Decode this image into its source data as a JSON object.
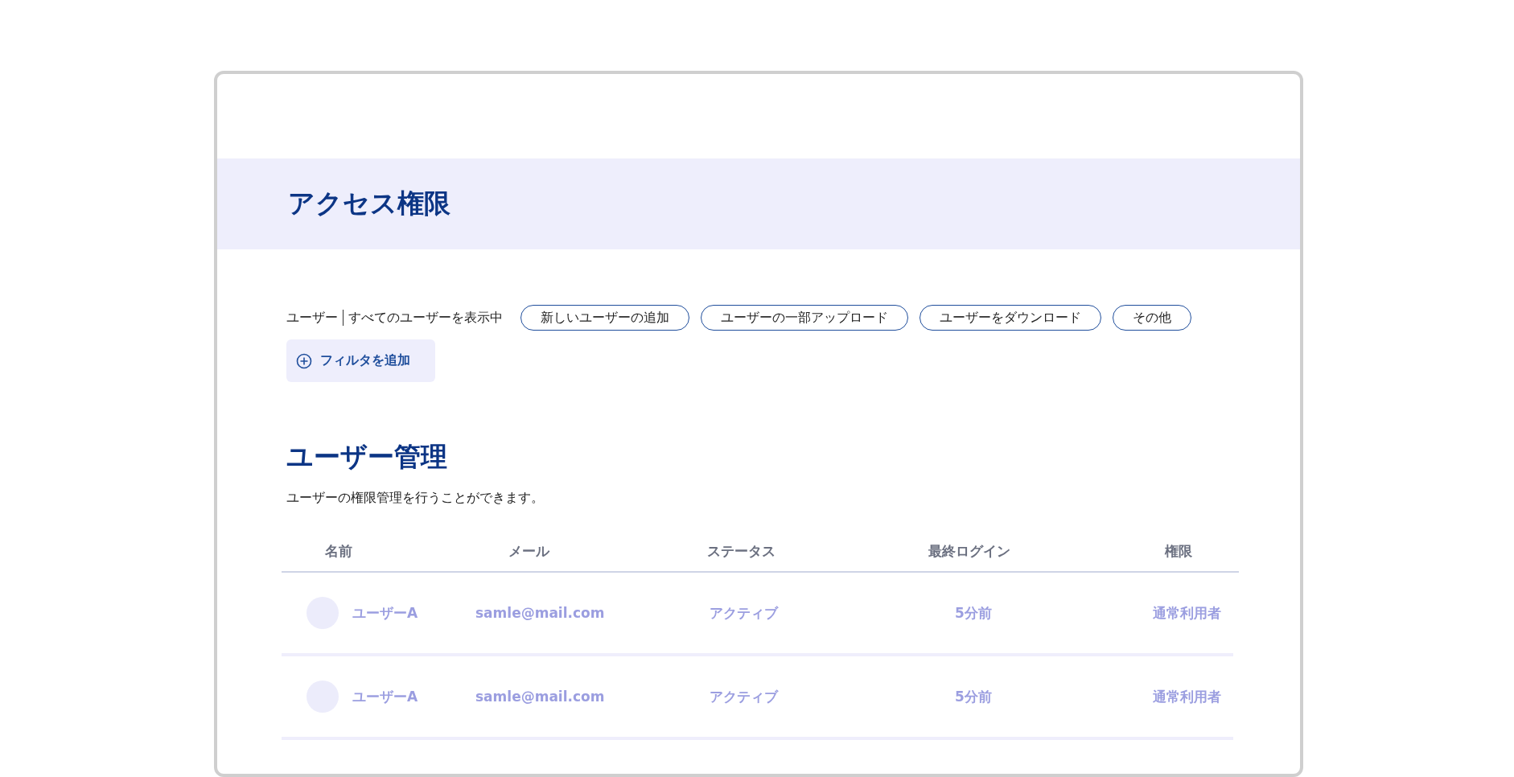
{
  "page": {
    "title": "アクセス権限"
  },
  "toolbar": {
    "label": "ユーザー",
    "filter_summary": "すべてのユーザーを表示中",
    "buttons": [
      "新しいユーザーの追加",
      "ユーザーの一部アップロード",
      "ユーザーをダウンロード",
      "その他"
    ],
    "add_filter": "フィルタを追加"
  },
  "section": {
    "title": "ユーザー管理",
    "description": "ユーザーの権限管理を行うことができます。"
  },
  "table": {
    "columns": [
      "名前",
      "メール",
      "ステータス",
      "最終ログイン",
      "権限"
    ],
    "rows": [
      {
        "name": "ユーザーA",
        "email": "samle@mail.com",
        "status": "アクティブ",
        "last_login": "5分前",
        "role": "通常利用者"
      },
      {
        "name": "ユーザーA",
        "email": "samle@mail.com",
        "status": "アクティブ",
        "last_login": "5分前",
        "role": "通常利用者"
      }
    ]
  }
}
